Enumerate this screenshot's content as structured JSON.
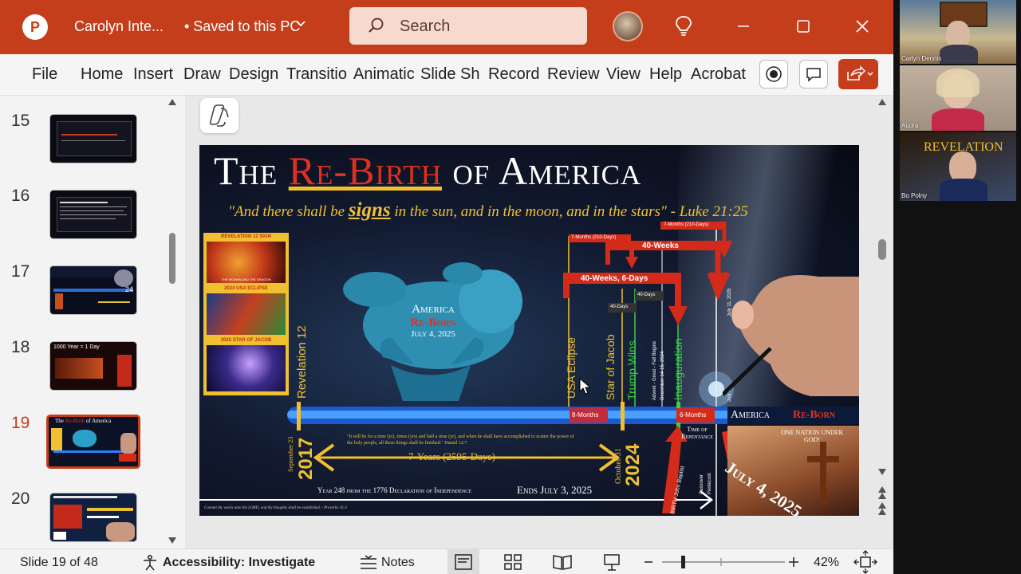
{
  "titlebar": {
    "app_logo": "P",
    "doc_title": "Carolyn Inte...",
    "saved_label": "• Saved to this PC",
    "search_placeholder": "Search"
  },
  "ribbon": {
    "tabs": [
      "File",
      "Home",
      "Insert",
      "Draw",
      "Design",
      "Transitio",
      "Animatic",
      "Slide Sh",
      "Record",
      "Review",
      "View",
      "Help",
      "Acrobat"
    ]
  },
  "thumbnails": {
    "items": [
      {
        "num": "15"
      },
      {
        "num": "16"
      },
      {
        "num": "17"
      },
      {
        "num": "18"
      },
      {
        "num": "19"
      },
      {
        "num": "20"
      }
    ],
    "selected": "19",
    "thumb18_text": "1000 Year = 1 Day",
    "thumb17_text": "24"
  },
  "slide": {
    "title_the": "The",
    "title_rebirth": "Re-Birth",
    "title_of_america": "of America",
    "quote_pre": "\"And there shall be ",
    "quote_signs": "signs",
    "quote_post": " in the sun, and in the moon, and in the stars\" - Luke 21:25",
    "panel_rev12": "REVELATION 12 SIGN",
    "panel_woman": "THE WOMAN AND THE DRAGON",
    "panel_eclipse": "2024 USA ECLIPSE",
    "panel_jacob": "2025 STAR OF JACOB",
    "baby_america": "America",
    "baby_reborn": "Re-Born",
    "baby_date": "July 4, 2025",
    "label_revelation": "Revelation 12",
    "label_usa_eclipse": "USA Eclipse",
    "label_star_jacob": "Star of Jacob",
    "label_trump_wins": "Trump Wins",
    "label_advent": "Advent - Great - Fall Begins",
    "label_dec": "December 14-15, 2024",
    "label_inauguration": "Inauguration",
    "label_july11": "July 11, 2025",
    "label_july4": "July 4",
    "months7_a": "7-Months (210-Days)",
    "months7_b": "7-Months (210-Days)",
    "weeks40": "40-Weeks",
    "weeks40_6days": "40-Weeks, 6-Days",
    "days40_a": "40-Days",
    "days40_b": "40-Days",
    "months8": "8-Months",
    "months6": "6-Months",
    "time_repentance": "Time of Repentance",
    "america_reborn_a": "America",
    "america_reborn_b": "Re-Born",
    "one_nation": "ONE NATION UNDER GOD!",
    "july4_2025": "July 4, 2025",
    "date_left_month": "September 23",
    "year_2017": "2017",
    "date_right_month": "October 31",
    "year_2024": "2024",
    "years7": "7-Years (2595-Days)",
    "daniel_quote": "\"It will be for a time (yr), times (yrs) and half a time (yr), and when he shall have accomplished to scatter the power of the holy people, all these things shall be finished.\" Daniel 12:7",
    "year248": "Year 248 from the 1776 Declaration of Independence",
    "ends": "Ends July 3, 2025",
    "birth_john": "BIRTH John Baptist",
    "passover": "Passover",
    "pentecost": "Pentecost",
    "proverbs": "Commit thy works unto the LORD, and thy thoughts shall be established. - Proverbs 16:3"
  },
  "statusbar": {
    "slide_info": "Slide 19 of 48",
    "accessibility": "Accessibility: Investigate",
    "notes": "Notes",
    "zoom": "42%"
  },
  "video": {
    "participants": [
      "Carlyn Dennis",
      "Audra",
      "Bo Polny"
    ],
    "rev_banner": "REVELATION"
  },
  "colors": {
    "ppt_red": "#c43e1c",
    "gold": "#f0c030",
    "slide_red": "#d42a1a"
  }
}
